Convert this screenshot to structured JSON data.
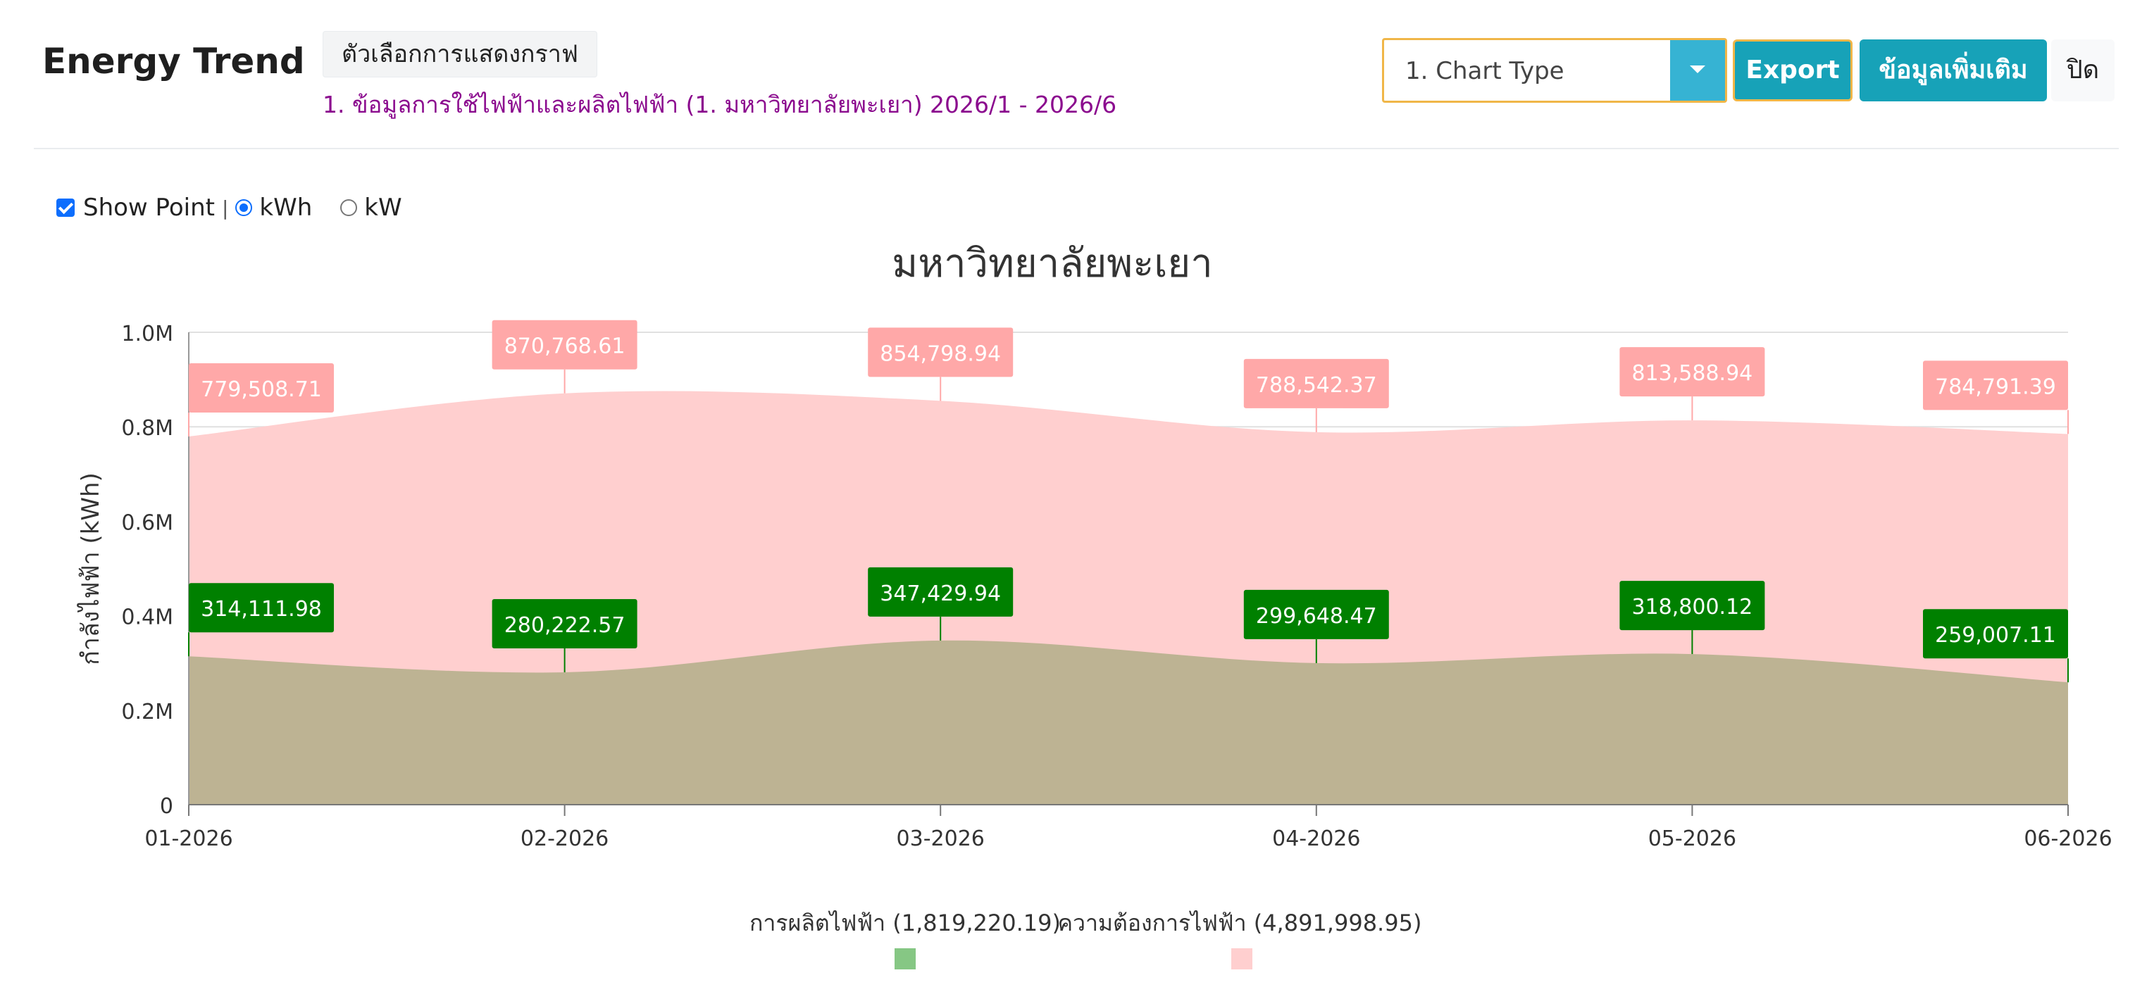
{
  "header": {
    "title": "Energy Trend",
    "options_button": "ตัวเลือกการแสดงกราฟ",
    "subtitle": "1. ข้อมูลการใช้ไฟฟ้าและผลิตไฟฟ้า (1. มหาวิทยาลัยพะเยา) 2026/1 - 2026/6",
    "chart_type_select": "1. Chart Type",
    "export_button": "Export",
    "more_info_button": "ข้อมูลเพิ่มเติม",
    "close_button": "ปิด"
  },
  "controls": {
    "show_point_label": "Show Point",
    "separator": "|",
    "unit_kwh": "kWh",
    "unit_kw": "kW",
    "show_point_checked": true,
    "selected_unit": "kWh"
  },
  "chart_data": {
    "type": "area",
    "title": "มหาวิทยาลัยพะเยา",
    "ylabel": "กำลังไฟฟ้า (kWh)",
    "xlabel": "",
    "categories": [
      "01-2026",
      "02-2026",
      "03-2026",
      "04-2026",
      "05-2026",
      "06-2026"
    ],
    "ylim": [
      0,
      1000000
    ],
    "yticks": [
      0,
      200000,
      400000,
      600000,
      800000,
      1000000
    ],
    "ytick_labels": [
      "0",
      "0.2M",
      "0.4M",
      "0.6M",
      "0.8M",
      "1.0M"
    ],
    "grid": true,
    "legend_position": "bottom",
    "series": [
      {
        "name": "ความต้องการไฟฟ้า",
        "legend_label": "ความต้องการไฟฟ้า (4,891,998.95)",
        "values": [
          779508.71,
          870768.61,
          854798.94,
          788542.37,
          813588.94,
          784791.39
        ],
        "value_labels": [
          "779,508.71",
          "870,768.61",
          "854,798.94",
          "788,542.37",
          "813,588.94",
          "784,791.39"
        ],
        "color": "#ffcfcf",
        "label_color": "#ffa8a8"
      },
      {
        "name": "การผลิตไฟฟ้า",
        "legend_label": "การผลิตไฟฟ้า (1,819,220.19)",
        "values": [
          314111.98,
          280222.57,
          347429.94,
          299648.47,
          318800.12,
          259007.11
        ],
        "value_labels": [
          "314,111.98",
          "280,222.57",
          "347,429.94",
          "299,648.47",
          "318,800.12",
          "259,007.11"
        ],
        "color": "#bdb393",
        "legend_color": "#86c784",
        "label_color": "#008000"
      }
    ]
  }
}
